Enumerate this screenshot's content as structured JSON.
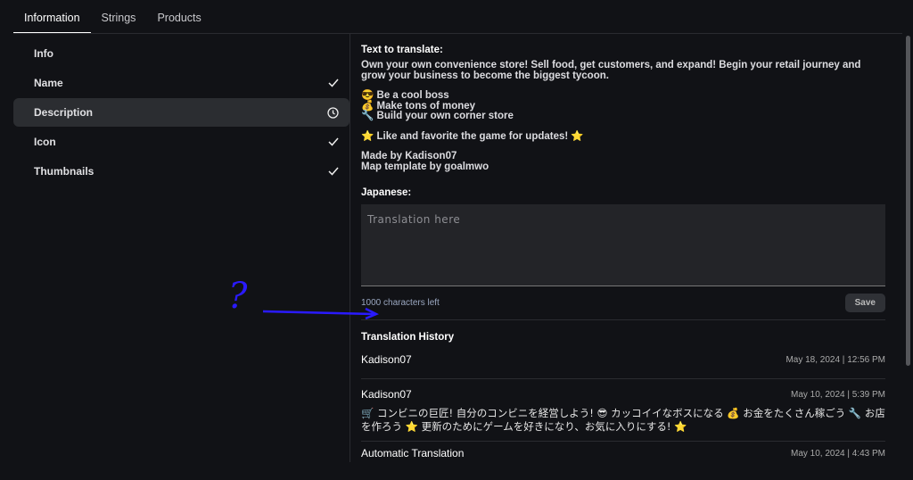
{
  "tabs": [
    {
      "label": "Information"
    },
    {
      "label": "Strings"
    },
    {
      "label": "Products"
    }
  ],
  "sidebar": {
    "items": [
      {
        "label": "Info",
        "status": ""
      },
      {
        "label": "Name",
        "status": "check"
      },
      {
        "label": "Description",
        "status": "clock"
      },
      {
        "label": "Icon",
        "status": "check"
      },
      {
        "label": "Thumbnails",
        "status": "check"
      }
    ]
  },
  "main": {
    "source_heading": "Text to translate:",
    "source_lines": [
      "Own your own convenience store! Sell food, get customers, and expand! Begin your retail journey and grow your business to become the biggest tycoon.",
      "😎 Be a cool boss",
      "💰 Make tons of money",
      "🔧 Build your own corner store",
      "⭐ Like and favorite the game for updates! ⭐",
      "Made by Kadison07",
      "Map template by goalmwo"
    ],
    "target_heading": "Japanese:",
    "placeholder": "Translation here",
    "chars_left": "1000 characters left",
    "save_label": "Save"
  },
  "history": {
    "heading": "Translation History",
    "entries": [
      {
        "author": "Kadison07",
        "date": "May 18, 2024 | 12:56 PM",
        "text": ""
      },
      {
        "author": "Kadison07",
        "date": "May 10, 2024 | 5:39 PM",
        "text": "🛒 コンビニの巨匠! 自分のコンビニを経営しよう! 😎 カッコイイなボスになる 💰 お金をたくさん稼ごう 🔧 お店を作ろう ⭐ 更新のためにゲームを好きになり、お気に入りにする! ⭐"
      },
      {
        "author": "Automatic Translation",
        "date": "May 10, 2024 | 4:43 PM",
        "text": ""
      }
    ]
  },
  "annotation": {
    "mark": "?",
    "color": "#2a1aff"
  }
}
